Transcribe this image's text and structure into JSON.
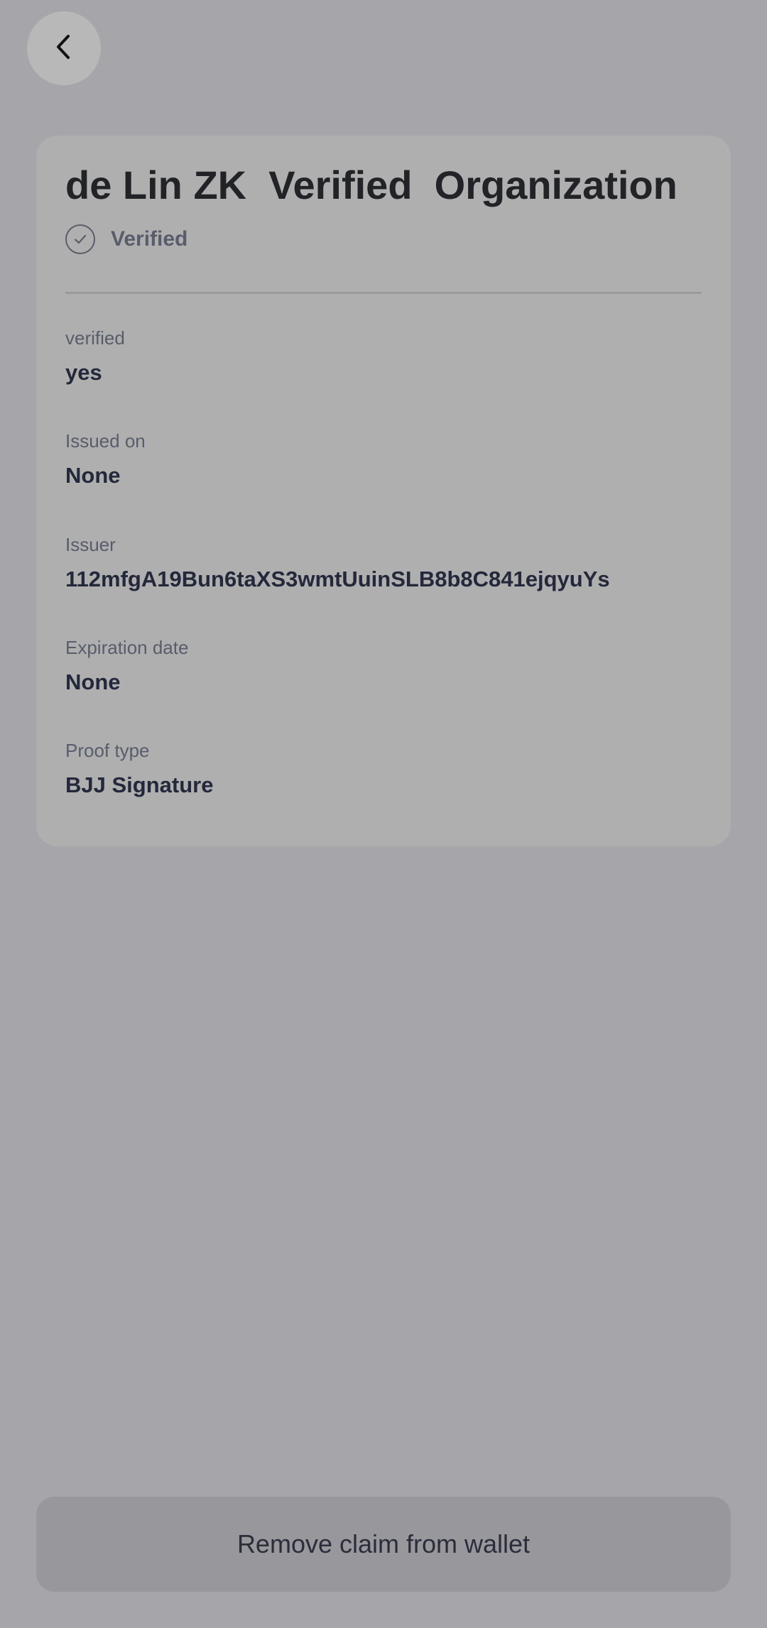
{
  "header": {
    "back_icon": "chevron-left-icon"
  },
  "claim": {
    "title": "de Lin ZK  Verified  Organization",
    "status_icon": "check-circle-icon",
    "status_label": "Verified",
    "fields": [
      {
        "label": "verified",
        "value": "yes"
      },
      {
        "label": "Issued on",
        "value": "None"
      },
      {
        "label": "Issuer",
        "value": "112mfgA19Bun6taXS3wmtUuinSLB8b8C841ejqyuYs"
      },
      {
        "label": "Expiration date",
        "value": "None"
      },
      {
        "label": "Proof type",
        "value": "BJJ Signature"
      }
    ]
  },
  "footer": {
    "remove_label": "Remove claim from wallet"
  },
  "colors": {
    "overlay_background": "#a6a5aa",
    "card_background": "#afafaf",
    "button_background": "#98989c"
  }
}
